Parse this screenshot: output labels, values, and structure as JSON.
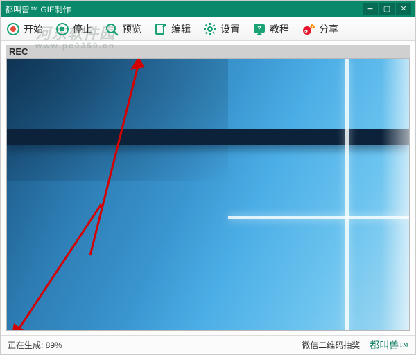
{
  "titlebar": {
    "title": "都叫兽™ GIF制作"
  },
  "toolbar": {
    "items": [
      {
        "label": "开始"
      },
      {
        "label": "停止"
      },
      {
        "label": "预览"
      },
      {
        "label": "编辑"
      },
      {
        "label": "设置"
      },
      {
        "label": "教程"
      },
      {
        "label": "分享"
      }
    ]
  },
  "watermark": {
    "line1": "河东软件园",
    "line2": "www.pc0359.cn"
  },
  "canvas": {
    "rec_label": "REC"
  },
  "statusbar": {
    "generating_text": "正在生成: 89%",
    "wechat_qr_text": "微信二维码抽奖",
    "brand": "都叫兽™"
  }
}
